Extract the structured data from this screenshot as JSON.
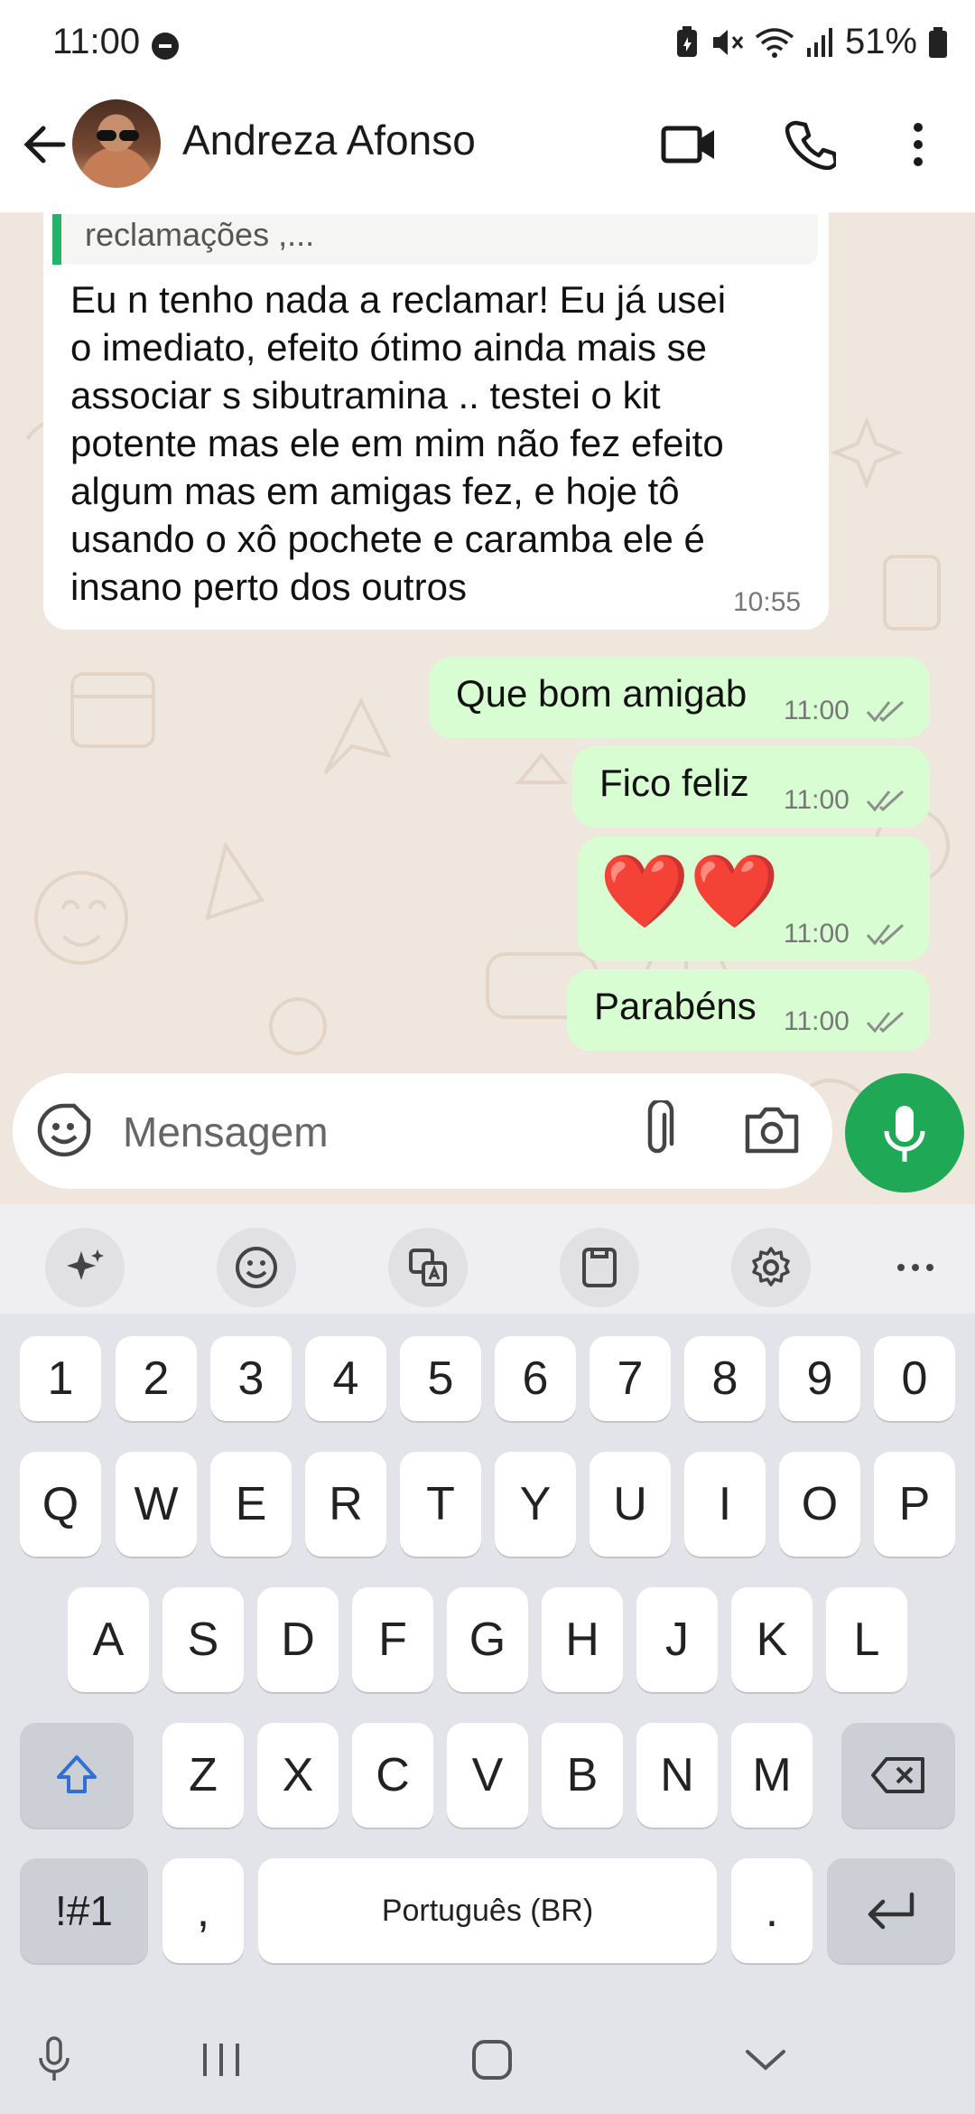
{
  "status": {
    "time": "11:00",
    "battery": "51%"
  },
  "header": {
    "contact_name": "Andreza Afonso"
  },
  "chat": {
    "quote_text": "reclamações ,...",
    "incoming": {
      "lines": [
        "Eu n tenho nada a reclamar! Eu já usei",
        "o imediato, efeito ótimo ainda mais se",
        "associar s sibutramina .. testei o kit",
        "potente mas ele em mim não fez efeito",
        "algum mas em amigas fez, e hoje tô",
        "usando o xô pochete e caramba ele é",
        "insano perto dos outros"
      ],
      "time": "10:55"
    },
    "outgoing": [
      {
        "text": "Que bom amigab",
        "time": "11:00"
      },
      {
        "text": "Fico feliz",
        "time": "11:00"
      },
      {
        "text": "❤️❤️",
        "time": "11:00"
      },
      {
        "text": "Parabéns",
        "time": "11:00"
      }
    ]
  },
  "input": {
    "placeholder": "Mensagem"
  },
  "keyboard": {
    "numbers": [
      "1",
      "2",
      "3",
      "4",
      "5",
      "6",
      "7",
      "8",
      "9",
      "0"
    ],
    "row1": [
      "Q",
      "W",
      "E",
      "R",
      "T",
      "Y",
      "U",
      "I",
      "O",
      "P"
    ],
    "row2": [
      "A",
      "S",
      "D",
      "F",
      "G",
      "H",
      "J",
      "K",
      "L"
    ],
    "row3": [
      "Z",
      "X",
      "C",
      "V",
      "B",
      "N",
      "M"
    ],
    "symbols_label": "!#1",
    "comma": ",",
    "space_label": "Português (BR)",
    "period": "."
  },
  "colors": {
    "accent": "#1fa855",
    "outgoing_bubble": "#d9fdd3",
    "chat_bg": "#efe7dd"
  }
}
